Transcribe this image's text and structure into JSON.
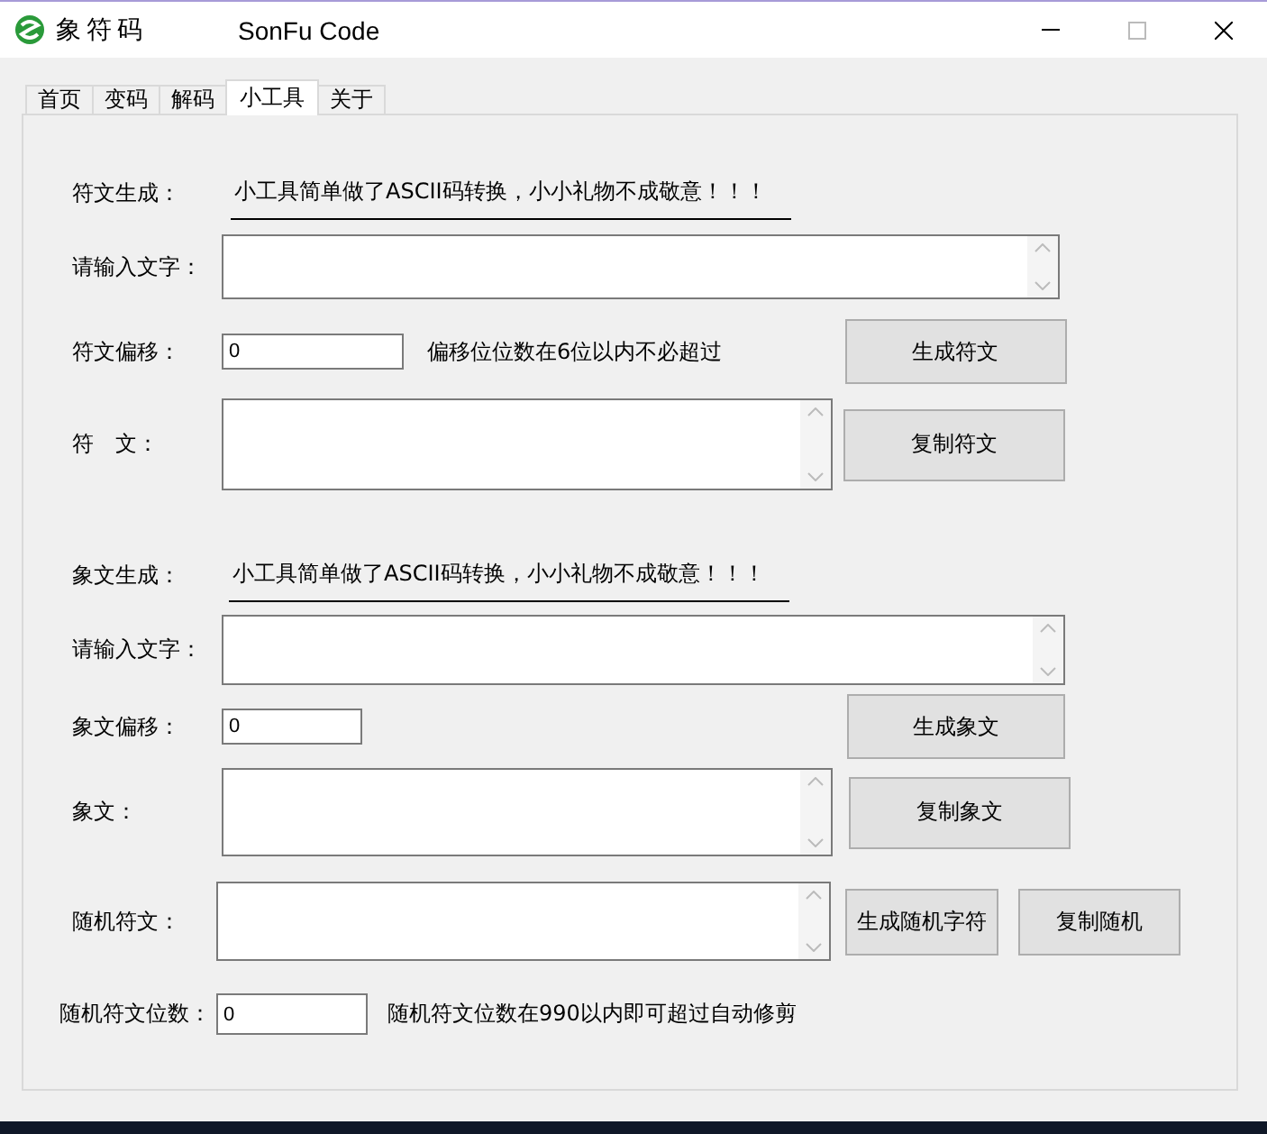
{
  "window": {
    "title": "象符码",
    "subtitle": "SonFu Code"
  },
  "tabs": [
    {
      "label": "首页",
      "selected": false
    },
    {
      "label": "变码",
      "selected": false
    },
    {
      "label": "解码",
      "selected": false
    },
    {
      "label": "小工具",
      "selected": true
    },
    {
      "label": "关于",
      "selected": false
    }
  ],
  "sections": [
    {
      "kind": "cipher",
      "heading": "符文生成：",
      "notice": "小工具简单做了ASCII码转换，小小礼物不成敬意！！！",
      "input_label": "请输入文字：",
      "offset_label": "符文偏移：",
      "offset_value": "0",
      "offset_hint": "偏移位位数在6位以内不必超过",
      "generate_button": "生成符文",
      "output_label": "符　文：",
      "copy_button": "复制符文"
    },
    {
      "kind": "cipher",
      "heading": "象文生成：",
      "notice": "小工具简单做了ASCII码转换，小小礼物不成敬意！！！",
      "input_label": "请输入文字：",
      "offset_label": "象文偏移：",
      "offset_value": "0",
      "generate_button": "生成象文",
      "output_label": "象文：",
      "copy_button": "复制象文"
    }
  ],
  "random": {
    "label": "随机符文：",
    "generate_button": "生成随机字符",
    "copy_button": "复制随机",
    "count_label": "随机符文位数：",
    "count_value": "0",
    "count_hint": "随机符文位数在990以内即可超过自动修剪"
  }
}
